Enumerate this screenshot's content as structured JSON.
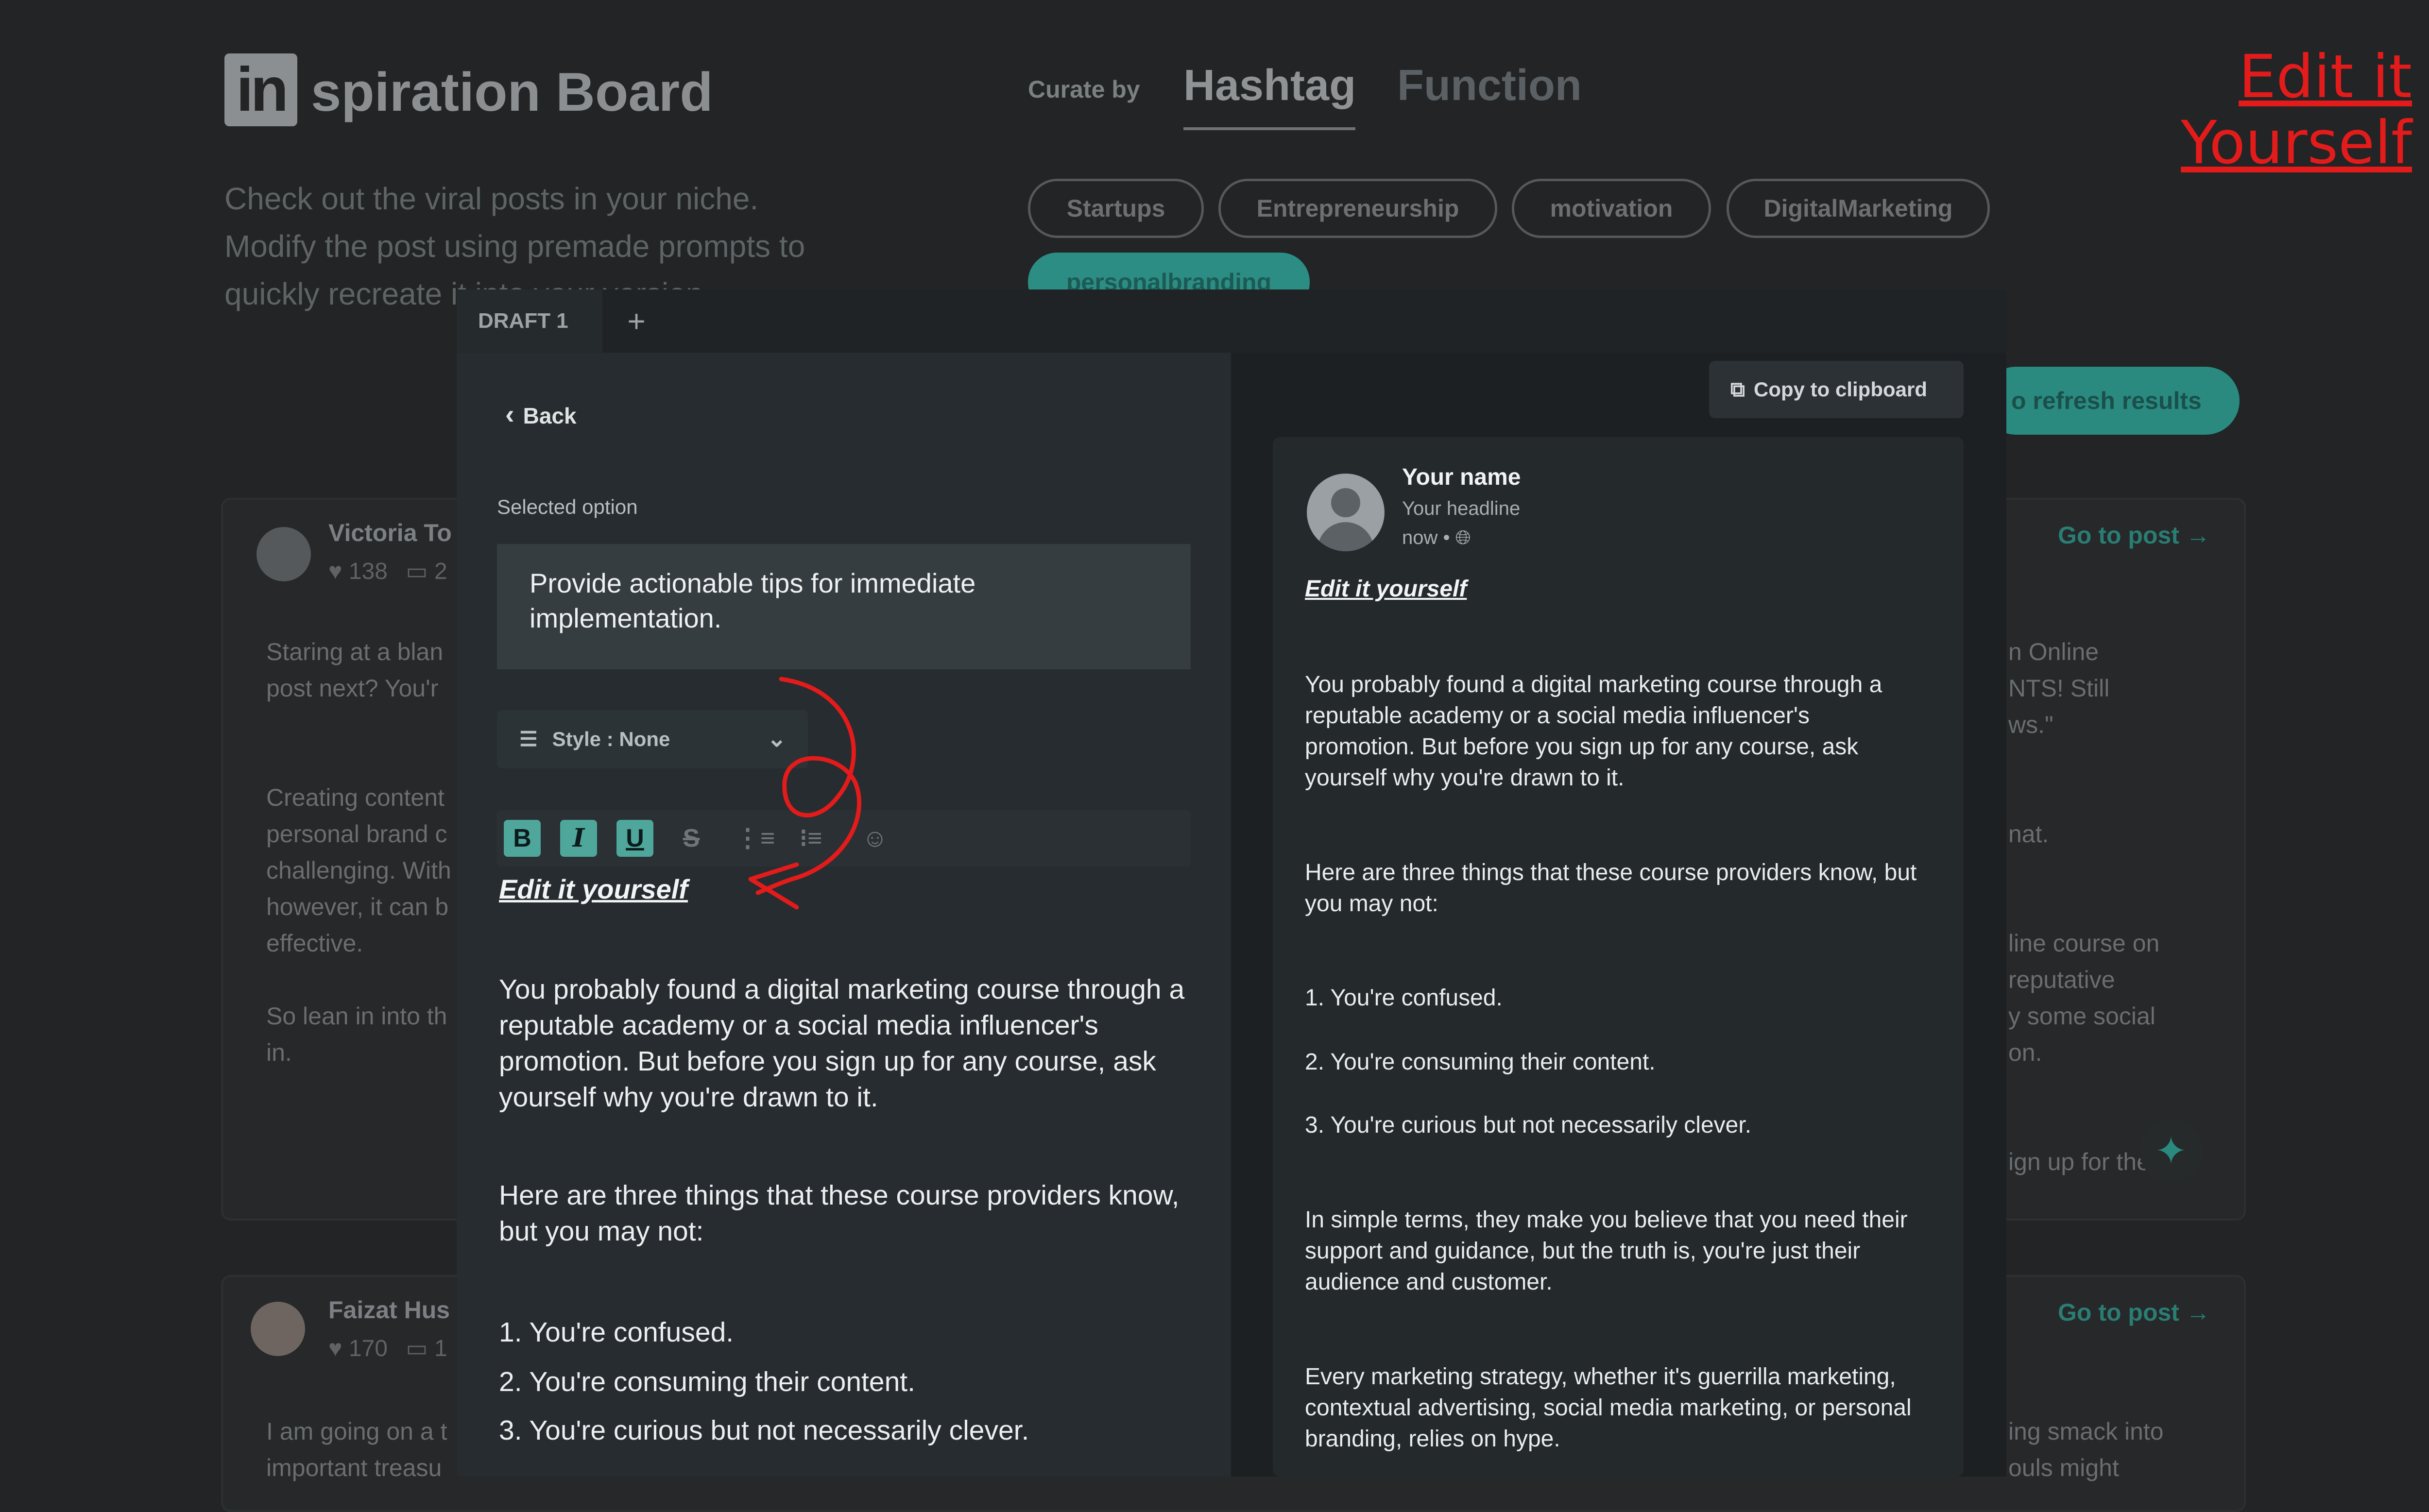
{
  "app": {
    "logo_mark": "in",
    "title": "spiration Board",
    "subtitle": "Check out the viral posts in your niche. Modify the post using premade prompts to quickly recreate it into your version"
  },
  "curate": {
    "label": "Curate by",
    "tabs": [
      "Hashtag",
      "Function"
    ],
    "active_tab": "Hashtag"
  },
  "hashtags": [
    "Startups",
    "Entrepreneurship",
    "motivation",
    "DigitalMarketing",
    "personalbranding"
  ],
  "selected_hashtag": "personalbranding",
  "refresh_label": "o refresh results",
  "feed": [
    {
      "author": "Victoria To",
      "likes": "138",
      "comments": "2",
      "go_to_post": "Go to post →",
      "text_left": "Staring at a blan\npost next? You'r\n\n\nCreating content\npersonal brand c\nchallenging. With\nhowever, it can b\neffective.\n\nSo lean in into th\nin.",
      "text_right": "n Online\nNTS! Still\nws.\"\n\n\nnat.\n\n\nline course on\nreputative\ny some social\non.\n\n\nign up for the"
    },
    {
      "author": "Faizat Hus",
      "likes": "170",
      "comments": "1",
      "go_to_post": "Go to post →",
      "text_left": "I am going on a t\nimportant treasu",
      "text_right": "ing smack into\nouls might"
    }
  ],
  "modal": {
    "tabs": [
      "DRAFT 1"
    ],
    "add_tab": "+",
    "back_label": "Back",
    "selected_option_label": "Selected option",
    "selected_option": "Provide actionable tips for immediate implementation.",
    "style_label": "Style : None",
    "toolbar": [
      "B",
      "I",
      "U",
      "S"
    ],
    "editor": {
      "heading": "Edit it yourself",
      "paragraphs": [
        "You probably found a digital marketing course through a reputable academy or a social media influencer's promotion. But before you sign up for any course, ask yourself why you're drawn to it.",
        "Here are three things that these course providers know, but you may not:",
        "1. You're confused.",
        "2. You're consuming their content.",
        "3. You're curious but not necessarily clever."
      ]
    },
    "copy_label": "Copy to clipboard",
    "preview": {
      "name": "Your name",
      "headline": "Your headline",
      "time": "now •",
      "heading": "Edit it yourself",
      "paragraphs": [
        "You probably found a digital marketing course through a reputable academy or a social media influencer's promotion. But before you sign up for any course, ask yourself why you're drawn to it.",
        "Here are three things that these course providers know, but you may not:",
        "1. You're confused.",
        "2. You're consuming their content.",
        "3. You're curious but not necessarily clever.",
        "In simple terms, they make you believe that you need their support and guidance, but the truth is, you're just their audience and customer.",
        "Every marketing strategy, whether it's guerrilla marketing, contextual advertising, social media marketing, or personal branding, relies on hype."
      ]
    }
  },
  "annotation": "Edit it Yourself",
  "colors": {
    "background": "#222425",
    "accent": "#2c8d84",
    "annotation": "#e31b1b"
  }
}
